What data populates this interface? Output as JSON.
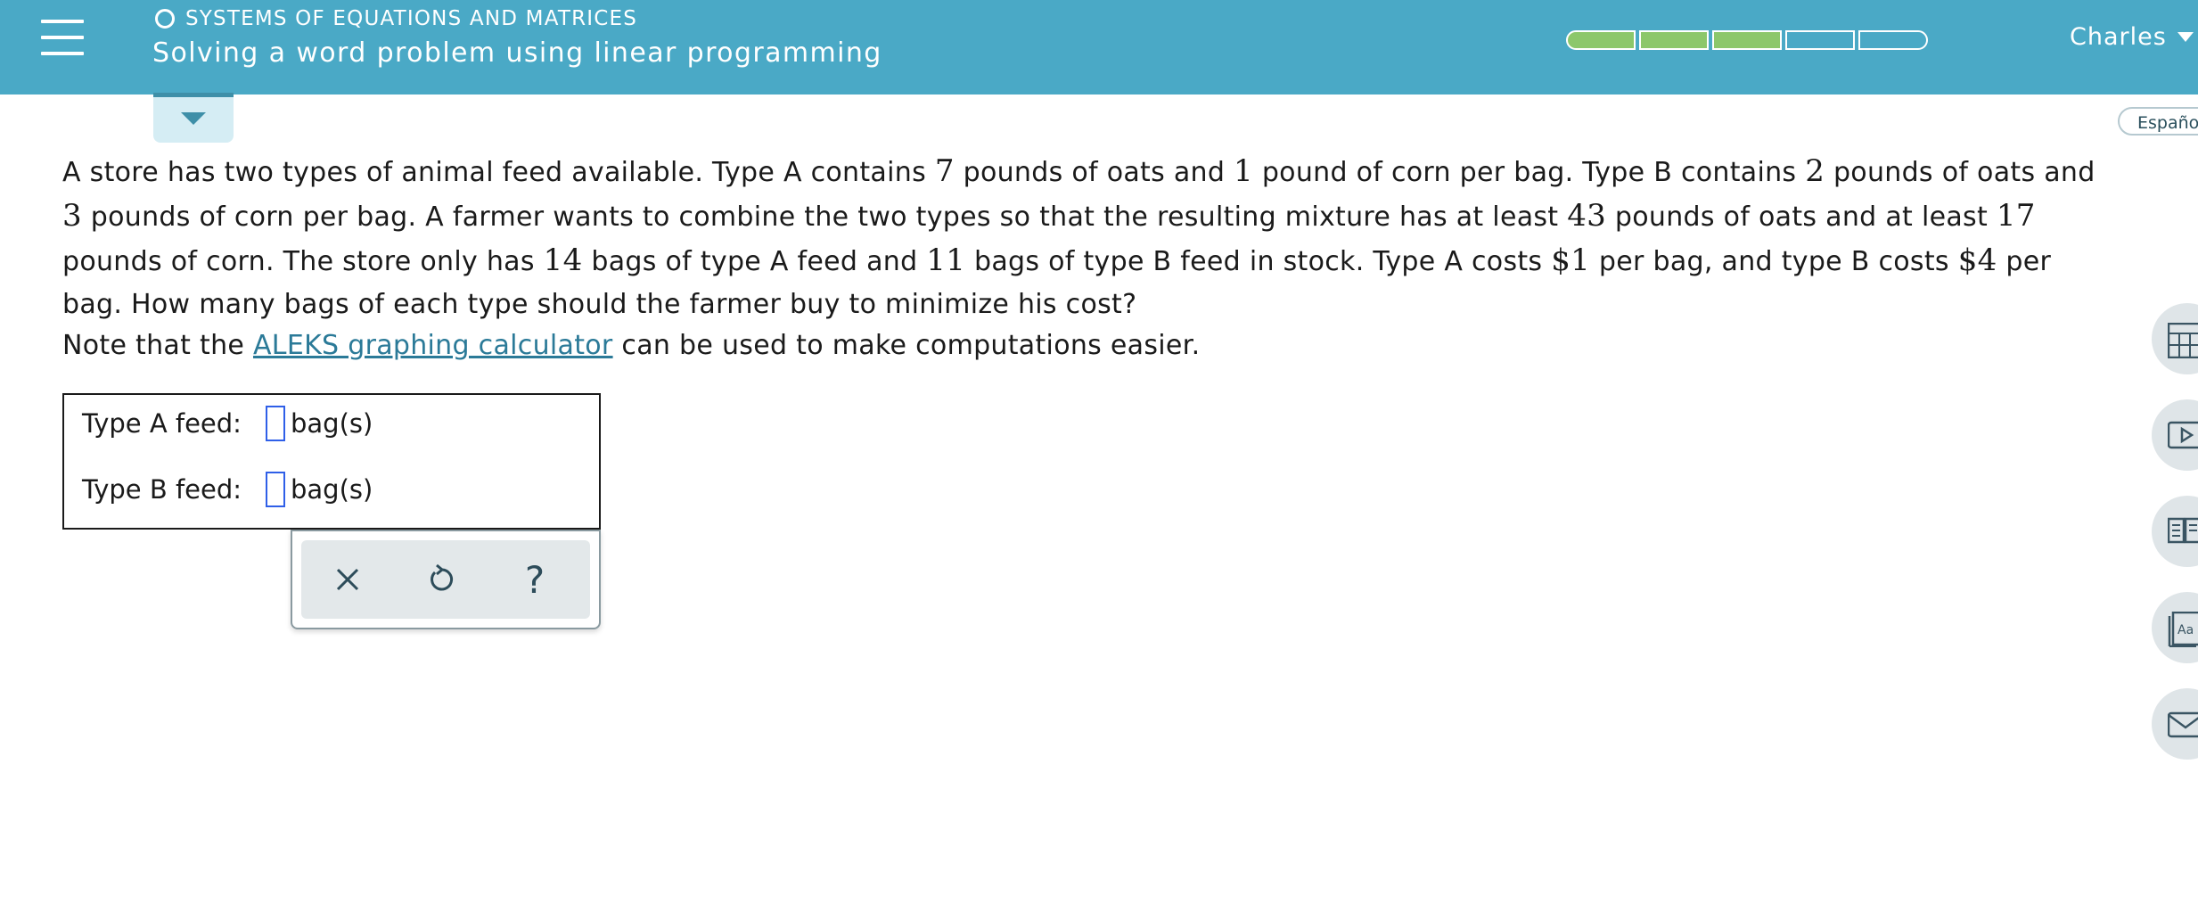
{
  "header": {
    "topic": "SYSTEMS OF EQUATIONS AND MATRICES",
    "lesson_title": "Solving a word problem using linear programming",
    "progress": {
      "filled_segments": 3,
      "total_segments": 5
    },
    "user_name": "Charles",
    "colors": {
      "bar": "#4aa9c6",
      "progress_fill": "#8cc76b"
    }
  },
  "language_button": "Español",
  "problem": {
    "p1": "A store has two types of animal feed available. Type A contains ",
    "n1": "7",
    "p2": " pounds of oats and ",
    "n2": "1",
    "p3": " pound of corn per bag. Type B contains ",
    "n3": "2",
    "p4": " pounds of oats and ",
    "n4": "3",
    "p5": " pounds of corn per bag. A farmer wants to combine the two types so that the resulting mixture has at least ",
    "n5": "43",
    "p6": " pounds of oats and at least ",
    "n6": "17",
    "p7": " pounds of corn. The store only has ",
    "n7": "14",
    "p8": " bags of type A feed and ",
    "n8": "11",
    "p9": " bags of type B feed in stock. Type A costs ",
    "n9": "$1",
    "p10": " per bag, and type B costs ",
    "n10": "$4",
    "p11": " per bag. How many bags of each type should the farmer buy to minimize his cost?"
  },
  "note": {
    "before": "Note that the ",
    "link": "ALEKS graphing calculator",
    "after": " can be used to make computations easier."
  },
  "answers": [
    {
      "label": "Type A feed:",
      "value": "",
      "unit": "bag(s)"
    },
    {
      "label": "Type B feed:",
      "value": "",
      "unit": "bag(s)"
    }
  ],
  "actions": {
    "help_glyph": "?"
  },
  "side_tools": [
    "calculator-icon",
    "video-icon",
    "textbook-icon",
    "dictionary-icon",
    "message-icon"
  ]
}
